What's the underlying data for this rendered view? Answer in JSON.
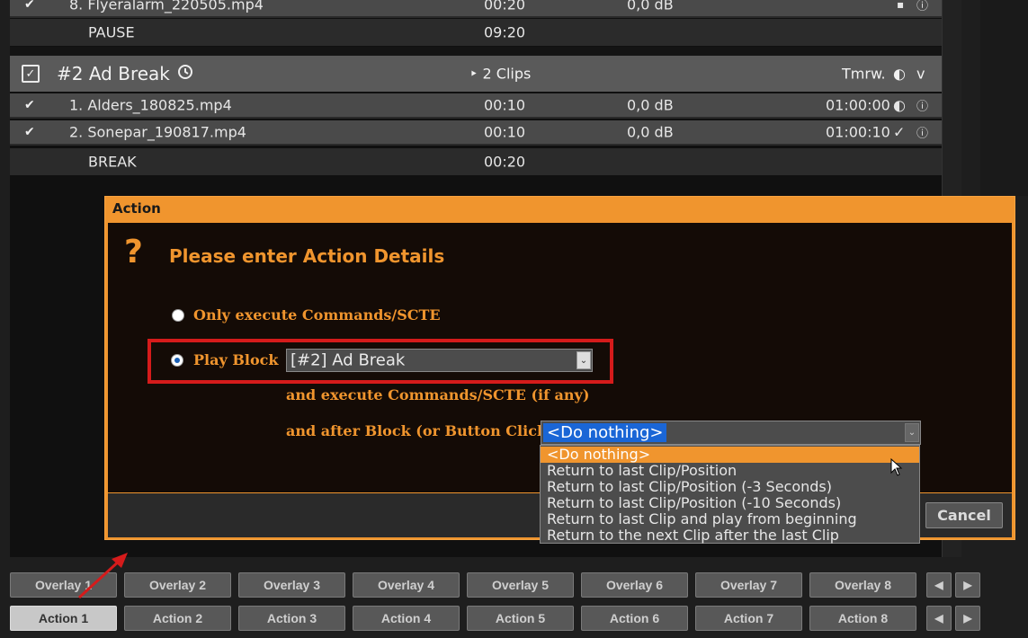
{
  "playlist": {
    "rows": [
      {
        "check": "✔",
        "name": "8. Flyeralarm_220505.mp4",
        "dur": "00:20",
        "db": "0,0 dB",
        "tail_icon": "▪",
        "info": "ⓘ"
      },
      {
        "name": "PAUSE",
        "dur": "09:20"
      }
    ],
    "block": {
      "check": "✓",
      "title": "#2  Ad Break",
      "clock_icon": "clock-icon",
      "clips": "‣ 2 Clips",
      "when": "Tmrw.",
      "half_icon": "◐",
      "chev": "v"
    },
    "block_rows": [
      {
        "check": "✔",
        "name": "1. Alders_180825.mp4",
        "dur": "00:10",
        "db": "0,0 dB",
        "time": "01:00:00",
        "status": "◐",
        "info": "ⓘ"
      },
      {
        "check": "✔",
        "name": "2. Sonepar_190817.mp4",
        "dur": "00:10",
        "db": "0,0 dB",
        "time": "01:00:10",
        "status": "✓",
        "info": "ⓘ"
      },
      {
        "name": "BREAK",
        "dur": "00:20"
      }
    ]
  },
  "dialog": {
    "title": "Action",
    "heading": "Please enter Action Details",
    "qmark": "?",
    "option1": "Only execute Commands/SCTE",
    "option2": "Play Block",
    "block_select": "[#2]  Ad Break",
    "exec_text": "and execute Commands/SCTE (if any)",
    "after_text": "and after Block (or Button Click)",
    "after_select": "<Do nothing>",
    "cancel": "Cancel",
    "after_options": [
      "<Do nothing>",
      "Return to last Clip/Position",
      "Return to last Clip/Position (-3 Seconds)",
      "Return to last Clip/Position (-10 Seconds)",
      "Return to last Clip and play from beginning",
      "Return to the next Clip after the last Clip"
    ]
  },
  "overlays": [
    "Overlay 1",
    "Overlay 2",
    "Overlay 3",
    "Overlay 4",
    "Overlay 5",
    "Overlay 6",
    "Overlay 7",
    "Overlay 8"
  ],
  "actions": [
    "Action 1",
    "Action 2",
    "Action 3",
    "Action 4",
    "Action 5",
    "Action 6",
    "Action 7",
    "Action 8"
  ],
  "nav": {
    "left": "◀",
    "right": "▶"
  },
  "colors": {
    "accent": "#f0952e",
    "highlight": "#d51b1b",
    "selection": "#1a66d6"
  }
}
